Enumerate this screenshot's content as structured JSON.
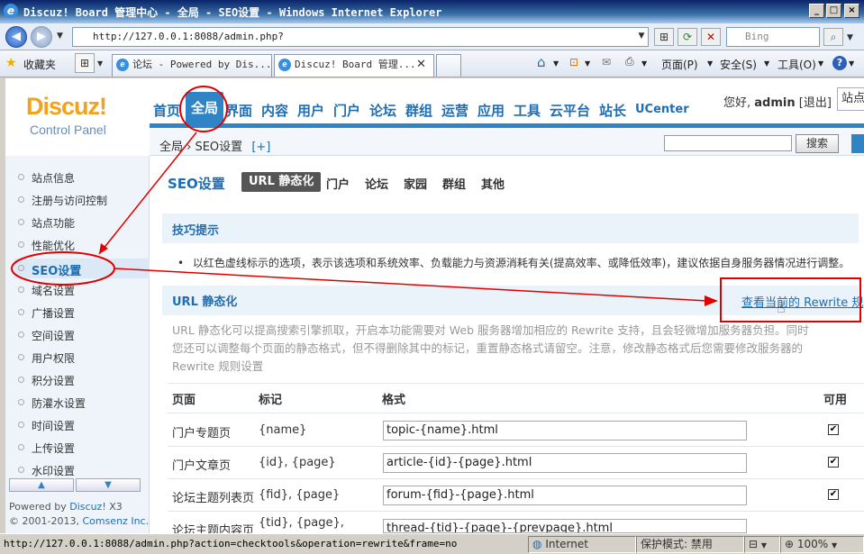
{
  "window": {
    "title": "Discuz! Board 管理中心 - 全局 - SEO设置 - Windows Internet Explorer",
    "min": "_",
    "max": "□",
    "close": "×"
  },
  "addressbar": {
    "url": "http://127.0.0.1:8088/admin.php?",
    "search_placeholder": "Bing"
  },
  "tabbar": {
    "favorites_label": "收藏夹",
    "tabs": [
      {
        "label": "论坛 - Powered by Dis..."
      },
      {
        "label": "Discuz! Board 管理..."
      }
    ],
    "commands": {
      "page": "页面(P)",
      "safety": "安全(S)",
      "tools": "工具(O)"
    }
  },
  "logo": {
    "brand": "Discuz!",
    "sub": "Control Panel"
  },
  "mainnav": [
    "首页",
    "全局",
    "界面",
    "内容",
    "用户",
    "门户",
    "论坛",
    "群组",
    "运营",
    "应用",
    "工具",
    "云平台",
    "站长",
    "UCenter"
  ],
  "user": {
    "greeting": "您好,",
    "name": "admin",
    "logout": "[退出]",
    "site": "站点"
  },
  "breadcrumb": {
    "text": "全局 › SEO设置",
    "add": "[+]"
  },
  "topsearch": {
    "button": "搜索"
  },
  "sidebar": {
    "items": [
      {
        "label": "站点信息"
      },
      {
        "label": "注册与访问控制"
      },
      {
        "label": "站点功能"
      },
      {
        "label": "性能优化"
      },
      {
        "label": "SEO设置"
      },
      {
        "label": "域名设置"
      },
      {
        "label": "广播设置"
      },
      {
        "label": "空间设置"
      },
      {
        "label": "用户权限"
      },
      {
        "label": "积分设置"
      },
      {
        "label": "防灌水设置"
      },
      {
        "label": "时间设置"
      },
      {
        "label": "上传设置"
      },
      {
        "label": "水印设置"
      }
    ],
    "powered_prefix": "Powered by ",
    "powered_brand": "Discuz!",
    "powered_version": " X3",
    "copyright_prefix": "© 2001-2013, ",
    "copyright_brand": "Comsenz Inc."
  },
  "content": {
    "section_title": "SEO设置",
    "subtabs": [
      "URL 静态化",
      "门户",
      "论坛",
      "家园",
      "群组",
      "其他"
    ],
    "tip_title": "技巧提示",
    "tip_text": "以红色虚线标示的选项，表示该选项和系统效率、负载能力与资源消耗有关(提高效率、或降低效率)，建议依据自身服务器情况进行调整。",
    "url_title": "URL 静态化",
    "rewrite_link": "查看当前的 Rewrite 规",
    "description": "URL 静态化可以提高搜索引擎抓取，开启本功能需要对 Web 服务器增加相应的 Rewrite 支持，且会轻微增加服务器负担。同时您还可以调整每个页面的静态格式，但不得删除其中的标记，重置静态格式请留空。注意，修改静态格式后您需要修改服务器的 Rewrite 规则设置",
    "table": {
      "headers": [
        "页面",
        "标记",
        "格式",
        "可用"
      ],
      "rows": [
        {
          "page": "门户专题页",
          "tags": "{name}",
          "format": "topic-{name}.html",
          "enabled": "✔"
        },
        {
          "page": "门户文章页",
          "tags": "{id}, {page}",
          "format": "article-{id}-{page}.html",
          "enabled": "✔"
        },
        {
          "page": "论坛主题列表页",
          "tags": "{fid}, {page}",
          "format": "forum-{fid}-{page}.html",
          "enabled": "✔"
        },
        {
          "page": "论坛主题内容页",
          "tags": "{tid}, {page},",
          "format": "thread-{tid}-{page}-{prevpage}.html",
          "enabled": "✔"
        }
      ]
    }
  },
  "statusbar": {
    "url": "http://127.0.0.1:8088/admin.php?action=checktools&operation=rewrite&frame=no",
    "zone": "Internet",
    "protected_mode": "保护模式: 禁用",
    "zoom": "100%"
  },
  "colors": {
    "accent": "#2f84c6",
    "brand_orange": "#f5a11c",
    "annotation_red": "#e00000"
  }
}
